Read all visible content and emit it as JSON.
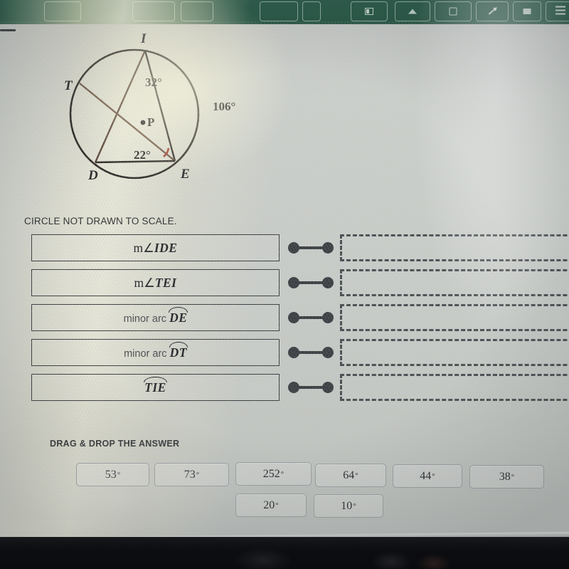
{
  "toolbar": {
    "background_color": "#2c5b4a",
    "buttons": [
      {
        "name": "tool-button-1",
        "icon": "rectangle-icon"
      },
      {
        "name": "tool-button-2",
        "icon": "rectangle-icon"
      },
      {
        "name": "tool-button-3",
        "icon": "layout-icon"
      },
      {
        "name": "tool-button-4",
        "icon": "caret-up-icon"
      },
      {
        "name": "tool-button-5",
        "icon": "rectangle-icon"
      },
      {
        "name": "tool-button-6",
        "icon": "square-icon"
      },
      {
        "name": "tool-button-7",
        "icon": "pen-icon"
      },
      {
        "name": "tool-button-8",
        "icon": "fill-icon"
      },
      {
        "name": "tool-button-9",
        "icon": "lines-icon"
      }
    ]
  },
  "diagram": {
    "caption": "CIRCLE NOT DRAWN TO SCALE.",
    "center_label": "P",
    "points": [
      {
        "label": "T",
        "position": "upper-left"
      },
      {
        "label": "I",
        "position": "top"
      },
      {
        "label": "E",
        "position": "bottom-right"
      },
      {
        "label": "D",
        "position": "bottom-left"
      }
    ],
    "angle_labels": [
      {
        "value": "32°",
        "vertex": "I",
        "color": "#242426"
      },
      {
        "value": "22°",
        "vertex": "E",
        "color": "#242426",
        "arc_color": "#9b3a28"
      },
      {
        "value": "106°",
        "vertex": "arc-outside-right",
        "color": "#242426"
      }
    ],
    "chords": [
      "I-D",
      "I-E",
      "T-E",
      "D-E"
    ]
  },
  "match_rows": [
    {
      "term_prefix": "m∠",
      "term_italic": "IDE",
      "term_plain": "",
      "arc": false,
      "answer": ""
    },
    {
      "term_prefix": "m∠",
      "term_italic": "TEI",
      "term_plain": "",
      "arc": false,
      "answer": ""
    },
    {
      "term_prefix": "",
      "term_italic": "DE",
      "term_plain": "minor arc ",
      "arc": true,
      "answer": ""
    },
    {
      "term_prefix": "",
      "term_italic": "DT",
      "term_plain": "minor arc ",
      "arc": true,
      "answer": ""
    },
    {
      "term_prefix": "",
      "term_italic": "TIE",
      "term_plain": "",
      "arc": true,
      "answer": ""
    }
  ],
  "answer_bank": {
    "label": "DRAG & DROP THE ANSWER",
    "row1": [
      {
        "value": "53",
        "unit": "°"
      },
      {
        "value": "73",
        "unit": "°"
      },
      {
        "value": "252",
        "unit": "°"
      },
      {
        "value": "64",
        "unit": "°"
      },
      {
        "value": "44",
        "unit": "°"
      },
      {
        "value": "38",
        "unit": "°"
      }
    ],
    "row2": [
      {
        "value": "20",
        "unit": "°"
      },
      {
        "value": "10",
        "unit": "°"
      }
    ]
  }
}
